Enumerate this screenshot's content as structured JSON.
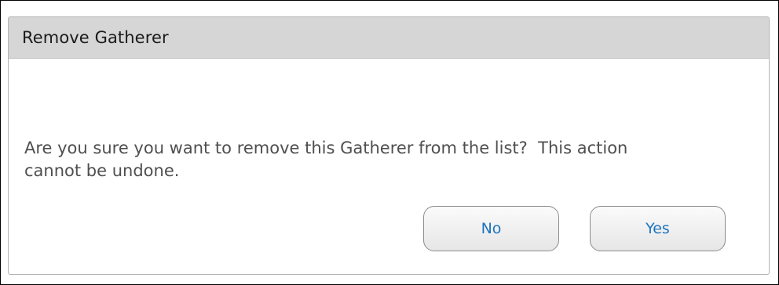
{
  "dialog": {
    "title": "Remove Gatherer",
    "message": "Are you sure you want to remove this Gatherer from the list?  This action\ncannot be undone.",
    "buttons": {
      "no_label": "No",
      "yes_label": "Yes"
    }
  },
  "colors": {
    "title_bar": "#d6d6d6",
    "button_text": "#1e73be",
    "message_text": "#4f4f4f"
  }
}
